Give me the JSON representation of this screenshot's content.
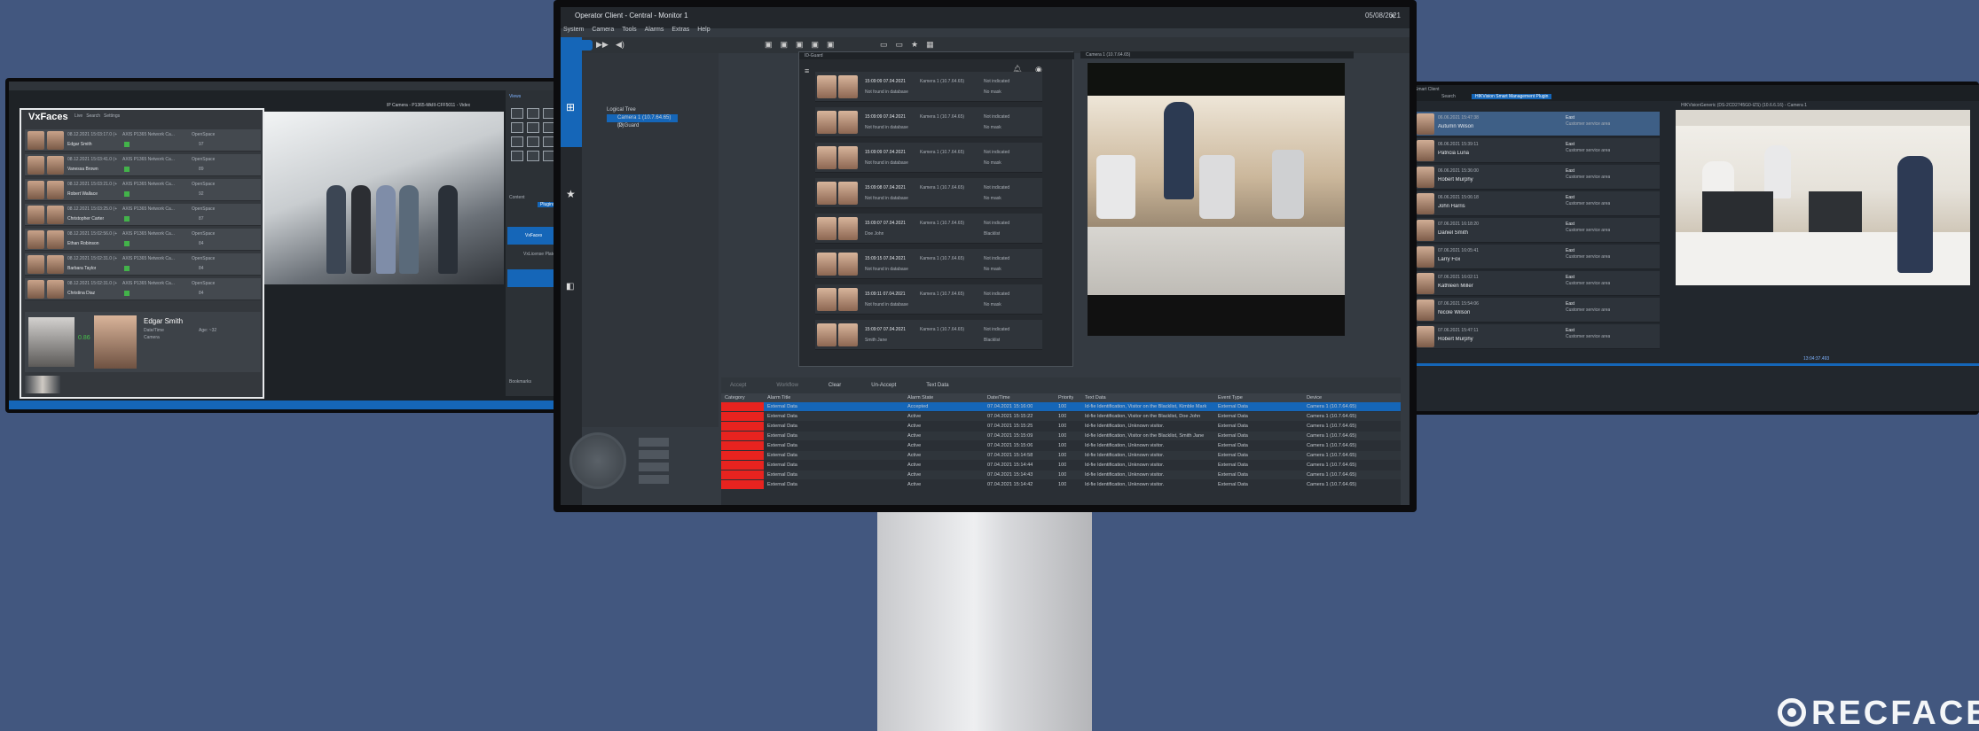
{
  "left": {
    "title": "VxFaces",
    "tabs": [
      "Live",
      "Search",
      "Settings"
    ],
    "rows": [
      {
        "time": "08.12.2021 15:03:17.0 (+",
        "camera": "AXIS P1365 Network Ca...",
        "name": "Edgar Smith",
        "place": "OpenSpace",
        "score": "97"
      },
      {
        "time": "08.12.2021 15:03:41.0 (+",
        "camera": "AXIS P1365 Network Ca...",
        "name": "Vanessa Brown",
        "place": "OpenSpace",
        "score": "89"
      },
      {
        "time": "08.12.2021 15:03:21.0 (+",
        "camera": "AXIS P1365 Network Ca...",
        "name": "Robert Wallace",
        "place": "OpenSpace",
        "score": "92"
      },
      {
        "time": "08.12.2021 15:03:25.0 (+",
        "camera": "AXIS P1365 Network Ca...",
        "name": "Christopher Carter",
        "place": "OpenSpace",
        "score": "87"
      },
      {
        "time": "08.12.2021 15:02:56.0 (+",
        "camera": "AXIS P1365 Network Ca...",
        "name": "Ethan Robinson",
        "place": "OpenSpace",
        "score": "84"
      },
      {
        "time": "08.12.2021 15:02:31.0 (+",
        "camera": "AXIS P1365 Network Ca...",
        "name": "Barbara Taylor",
        "place": "OpenSpace",
        "score": "84"
      },
      {
        "time": "08.12.2021 15:02:31.0 (+",
        "camera": "AXIS P1365 Network Ca...",
        "name": "Christina Diaz",
        "place": "OpenSpace",
        "score": "84"
      }
    ],
    "detail": {
      "name": "Edgar Smith",
      "score": "0.86",
      "age": "Age: ~32",
      "label_time": "Date/Time",
      "label_camera": "Camera"
    },
    "camera_title": "IP Camera - P1365-MkIII-CFF5011 - Video",
    "plugin_side": [
      "Views",
      "Content",
      "Plugins",
      "VxFaces",
      "VxLicense Plate",
      "Bookmarks"
    ]
  },
  "center": {
    "window_title": "Operator Client - Central - Monitor 1",
    "date": "05/08/2021",
    "menu": [
      "System",
      "Camera",
      "Tools",
      "Alarms",
      "Extras",
      "Help"
    ],
    "tree": {
      "root": "Logical Tree",
      "items": [
        "Camera 1 (10.7.64.65) (2)",
        "ID Guard"
      ]
    },
    "idguard_title": "ID-Guard",
    "camera_pane_title": "Camera 1 (10.7.64.65)",
    "cards": [
      {
        "time": "15:09:09 07.04.2021",
        "cam": "Kamera 1 (10.7.64.65)",
        "status": "Not indicated",
        "db": "Not found in database",
        "mask": "No mask"
      },
      {
        "time": "15:09:09 07.04.2021",
        "cam": "Kamera 1 (10.7.64.65)",
        "status": "Not indicated",
        "db": "Not found in database",
        "mask": "No mask"
      },
      {
        "time": "15:09:09 07.04.2021",
        "cam": "Kamera 1 (10.7.64.65)",
        "status": "Not indicated",
        "db": "Not found in database",
        "mask": "No mask"
      },
      {
        "time": "15:09:08 07.04.2021",
        "cam": "Kamera 1 (10.7.64.65)",
        "status": "Not indicated",
        "db": "Not found in database",
        "mask": "No mask"
      },
      {
        "time": "15:09:07 07.04.2021",
        "cam": "Kamera 1 (10.7.64.65)",
        "status": "Not indicated",
        "db": "Doe John",
        "mask": "Blacklist"
      },
      {
        "time": "15:09:15 07.04.2021",
        "cam": "Kamera 1 (10.7.64.65)",
        "status": "Not indicated",
        "db": "Not found in database",
        "mask": "No mask"
      },
      {
        "time": "15:09:11 07.04.2021",
        "cam": "Kamera 1 (10.7.64.65)",
        "status": "Not indicated",
        "db": "Not found in database",
        "mask": "No mask"
      },
      {
        "time": "15:09:07 07.04.2021",
        "cam": "Kamera 1 (10.7.64.65)",
        "status": "Not indicated",
        "db": "Smith Jane",
        "mask": "Blacklist"
      }
    ],
    "actions": [
      "Accept",
      "Workflow",
      "Clear",
      "Un-Accept",
      "Text Data"
    ],
    "columns": [
      "Category",
      "Alarm Title",
      "Alarm State",
      "Date/Time",
      "Priority",
      "Text Data",
      "Event Type",
      "Device"
    ],
    "alarms": [
      {
        "title": "External Data",
        "state": "Accepted",
        "dt": "07.04.2021 15:16:00",
        "prio": "100",
        "text": "Id-fie Identification, Visitor on the Blacklist, Kimble Mark",
        "event": "External Data",
        "device": "Camera 1 (10.7.64.65)"
      },
      {
        "title": "External Data",
        "state": "Active",
        "dt": "07.04.2021 15:15:22",
        "prio": "100",
        "text": "Id-fie Identification, Visitor on the Blacklist, Doe John",
        "event": "External Data",
        "device": "Camera 1 (10.7.64.65)"
      },
      {
        "title": "External Data",
        "state": "Active",
        "dt": "07.04.2021 15:15:25",
        "prio": "100",
        "text": "Id-fie Identification, Unknown visitor.",
        "event": "External Data",
        "device": "Camera 1 (10.7.64.65)"
      },
      {
        "title": "External Data",
        "state": "Active",
        "dt": "07.04.2021 15:15:09",
        "prio": "100",
        "text": "Id-fie Identification, Visitor on the Blacklist, Smith Jane",
        "event": "External Data",
        "device": "Camera 1 (10.7.64.65)"
      },
      {
        "title": "External Data",
        "state": "Active",
        "dt": "07.04.2021 15:15:06",
        "prio": "100",
        "text": "Id-fie Identification, Unknown visitor.",
        "event": "External Data",
        "device": "Camera 1 (10.7.64.65)"
      },
      {
        "title": "External Data",
        "state": "Active",
        "dt": "07.04.2021 15:14:58",
        "prio": "100",
        "text": "Id-fie Identification, Unknown visitor.",
        "event": "External Data",
        "device": "Camera 1 (10.7.64.65)"
      },
      {
        "title": "External Data",
        "state": "Active",
        "dt": "07.04.2021 15:14:44",
        "prio": "100",
        "text": "Id-fie Identification, Unknown visitor.",
        "event": "External Data",
        "device": "Camera 1 (10.7.64.65)"
      },
      {
        "title": "External Data",
        "state": "Active",
        "dt": "07.04.2021 15:14:43",
        "prio": "100",
        "text": "Id-fie Identification, Unknown visitor.",
        "event": "External Data",
        "device": "Camera 1 (10.7.64.65)"
      },
      {
        "title": "External Data",
        "state": "Active",
        "dt": "07.04.2021 15:14:42",
        "prio": "100",
        "text": "Id-fie Identification, Unknown visitor.",
        "event": "External Data",
        "device": "Camera 1 (10.7.64.65)"
      }
    ]
  },
  "right": {
    "window_title": "Smart Client",
    "tabs": [
      "Search",
      "HIKVision Smart Management Plugin"
    ],
    "camera_title": "HIKVisionGeneric (DS-2CD2745G0-IZS) (10.6.6.16) - Camera 1",
    "rows": [
      {
        "date": "06.06.2021 15:47:38",
        "name": "Autumn Wilson",
        "place": "East",
        "info": "Customer service area"
      },
      {
        "date": "06.06.2021 15:39:11",
        "name": "Patricia Luna",
        "place": "East",
        "info": "Customer service area"
      },
      {
        "date": "06.06.2021 15:36:00",
        "name": "Robert Murphy",
        "place": "East",
        "info": "Customer service area"
      },
      {
        "date": "06.06.2021 15:06:18",
        "name": "John Harris",
        "place": "East",
        "info": "Customer service area"
      },
      {
        "date": "07.06.2021 16:18:20",
        "name": "Daniel Smith",
        "place": "East",
        "info": "Customer service area"
      },
      {
        "date": "07.06.2021 16:05:41",
        "name": "Larry Fox",
        "place": "East",
        "info": "Customer service area"
      },
      {
        "date": "07.06.2021 16:02:11",
        "name": "Kathleen Miller",
        "place": "East",
        "info": "Customer service area"
      },
      {
        "date": "07.06.2021 15:54:06",
        "name": "Nicole Wilson",
        "place": "East",
        "info": "Customer service area"
      },
      {
        "date": "07.06.2021 15:47:11",
        "name": "Robert Murphy",
        "place": "East",
        "info": "Customer service area"
      }
    ],
    "time": "13:04:37.493"
  },
  "logo": "RECFACES",
  "colors": {
    "background": "#42577f",
    "accent": "#1566b8",
    "alarm_red": "#e8231f"
  }
}
